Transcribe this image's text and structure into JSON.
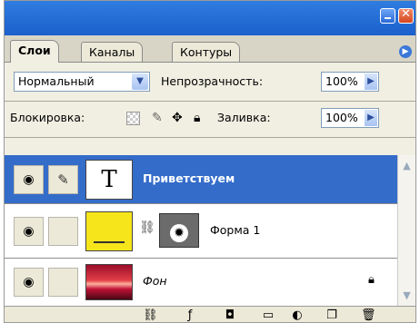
{
  "tabs": [
    {
      "label": "Слои"
    },
    {
      "label": "Каналы"
    },
    {
      "label": "Контуры"
    }
  ],
  "blend_mode": {
    "value": "Нормальный"
  },
  "opacity": {
    "label": "Непрозрачность:",
    "value": "100%"
  },
  "lock": {
    "label": "Блокировка:"
  },
  "fill": {
    "label": "Заливка:",
    "value": "100%"
  },
  "layers": [
    {
      "name": "Приветствуем",
      "type": "text",
      "thumb_text": "T",
      "selected": true
    },
    {
      "name": "Форма 1",
      "type": "shape",
      "selected": false
    },
    {
      "name": "Фон",
      "type": "background",
      "selected": false
    }
  ],
  "colors": {
    "accent": "#346cc9",
    "shape_fill": "#f6e51a"
  },
  "icons": {
    "eye": "eye-icon",
    "brush": "brush-icon",
    "chain": "chain-icon",
    "lock": "lock-icon",
    "move": "move-icon",
    "fx": "fx-icon",
    "mask": "mask-icon",
    "folder": "folder-icon",
    "adjustment": "adjustment-icon",
    "new_layer": "new-layer-icon",
    "trash": "trash-icon"
  }
}
